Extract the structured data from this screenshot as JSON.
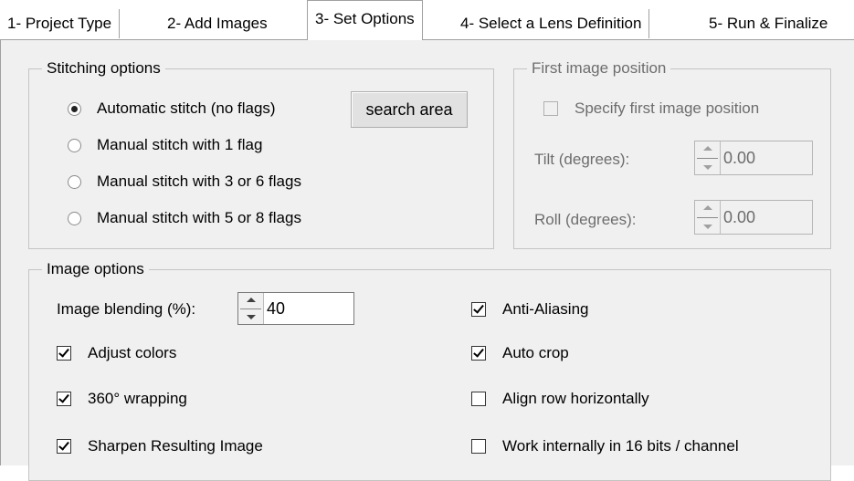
{
  "tabs": [
    {
      "label": "1- Project Type"
    },
    {
      "label": "2- Add Images"
    },
    {
      "label": "3- Set Options"
    },
    {
      "label": "4- Select a Lens Definition"
    },
    {
      "label": "5- Run & Finalize"
    }
  ],
  "active_tab": "3- Set Options",
  "stitching": {
    "title": "Stitching options",
    "options": [
      {
        "label": "Automatic stitch (no flags)",
        "selected": true
      },
      {
        "label": "Manual stitch with 1 flag",
        "selected": false
      },
      {
        "label": "Manual stitch with 3 or 6 flags",
        "selected": false
      },
      {
        "label": "Manual stitch with 5 or 8 flags",
        "selected": false
      }
    ],
    "search_button": "search area"
  },
  "first_image": {
    "title": "First image position",
    "specify_label": "Specify first image position",
    "specify_checked": false,
    "enabled": false,
    "tilt_label": "Tilt (degrees):",
    "tilt_value": "0.00",
    "roll_label": "Roll (degrees):",
    "roll_value": "0.00"
  },
  "image_options": {
    "title": "Image options",
    "blending_label": "Image blending (%):",
    "blending_value": "40",
    "left": [
      {
        "label": "Adjust colors",
        "checked": true
      },
      {
        "label": "360° wrapping",
        "checked": true
      },
      {
        "label": "Sharpen Resulting Image",
        "checked": true
      }
    ],
    "right": [
      {
        "label": "Anti-Aliasing",
        "checked": true
      },
      {
        "label": "Auto crop",
        "checked": true
      },
      {
        "label": "Align row horizontally",
        "checked": false
      },
      {
        "label": "Work internally in 16 bits / channel",
        "checked": false
      }
    ]
  }
}
